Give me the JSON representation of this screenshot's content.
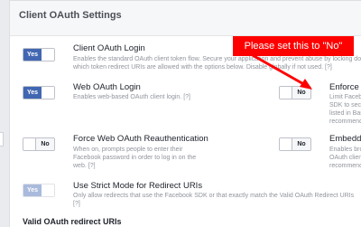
{
  "header": {
    "title": "Client OAuth Settings"
  },
  "settings": {
    "client_oauth_login": {
      "title": "Client OAuth Login",
      "toggle": "Yes",
      "desc1": "Enables the standard OAuth client token flow. Secure your application and prevent abuse by locking down",
      "desc2": "which token redirect URIs are allowed with the options below. Disable globally if not used.",
      "help": "[?]"
    },
    "web_oauth_login": {
      "title": "Web OAuth Login",
      "toggle": "Yes",
      "desc1": "Enables web-based OAuth client login.",
      "help": "[?]"
    },
    "enforce_https": {
      "title": "Enforce HT",
      "toggle": "No",
      "desc1": "Limit Faceboo",
      "desc2": "SDK to secu",
      "desc3": "listed in Basi",
      "desc4": "recommended"
    },
    "force_web_reauth": {
      "title": "Force Web OAuth Reauthentication",
      "toggle": "No",
      "desc1": "When on, prompts people to enter their",
      "desc2": "Facebook password in order to log in on the",
      "desc3": "web.",
      "help": "[?]"
    },
    "embedded": {
      "title": "Embedded",
      "toggle": "No",
      "desc1": "Enables brow",
      "desc2": "OAuth client",
      "desc3": "recommended"
    },
    "strict_mode": {
      "title": "Use Strict Mode for Redirect URIs",
      "toggle": "Yes",
      "desc1": "Only allow redirects that use the Facebook SDK or that exactly match the Valid OAuth Redirect URIs",
      "desc2": "[?]"
    }
  },
  "footer": {
    "label": "Valid OAuth redirect URIs"
  },
  "annotation": {
    "text": "Please set this to \"No\"",
    "color": "#ff0000"
  },
  "colors": {
    "accent": "#4267b2",
    "annotation": "#ff0000"
  }
}
